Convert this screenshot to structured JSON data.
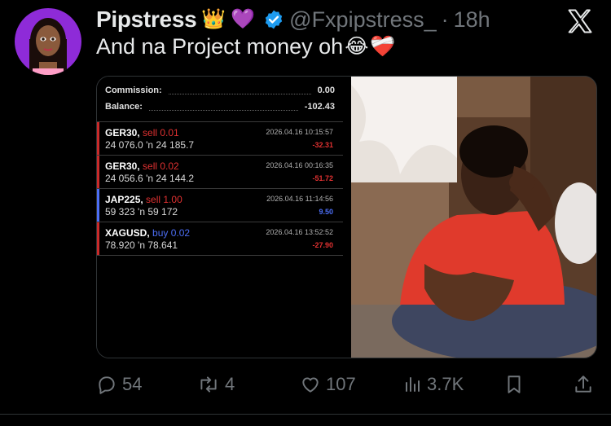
{
  "post": {
    "display_name": "Pipstress",
    "name_emojis": [
      "👑",
      "💜"
    ],
    "handle": "@Fxpipstress_",
    "separator": "·",
    "time_ago": "18h",
    "text": "And na Project money oh",
    "text_emojis": [
      "😂",
      "❤️‍🩹"
    ]
  },
  "trade_panel": {
    "commission_label": "Commission:",
    "commission_value": "0.00",
    "balance_label": "Balance:",
    "balance_value": "-102.43",
    "trades": [
      {
        "symbol": "GER30,",
        "direction": "sell 0.01",
        "dir_type": "sell",
        "open": "24 076.0",
        "arrow": "'n",
        "close": "24 185.7",
        "date": "2026.04.16 10:15:57",
        "profit": "-32.31",
        "profit_color": "#e03131"
      },
      {
        "symbol": "GER30,",
        "direction": "sell 0.02",
        "dir_type": "sell",
        "open": "24 056.6",
        "arrow": "'n",
        "close": "24 144.2",
        "date": "2026.04.16 00:16:35",
        "profit": "-51.72",
        "profit_color": "#e03131"
      },
      {
        "symbol": "JAP225,",
        "direction": "sell 1.00",
        "dir_type": "sell",
        "open": "59 323",
        "arrow": "'n",
        "close": "59 172",
        "date": "2026.04.16 11:14:56",
        "profit": "9.50",
        "profit_color": "#4c6ef5"
      },
      {
        "symbol": "XAGUSD,",
        "direction": "buy 0.02",
        "dir_type": "buy",
        "open": "78.920",
        "arrow": "'n",
        "close": "78.641",
        "date": "2026.04.16 13:52:52",
        "profit": "-27.90",
        "profit_color": "#e03131"
      }
    ]
  },
  "actions": {
    "replies": "54",
    "reposts": "4",
    "likes": "107",
    "views": "3.7K"
  },
  "colors": {
    "background": "#000000",
    "text_primary": "#e7e9ea",
    "text_secondary": "#71767b",
    "verified": "#1d9bf0",
    "avatar_bg": "#8e2bd8"
  }
}
